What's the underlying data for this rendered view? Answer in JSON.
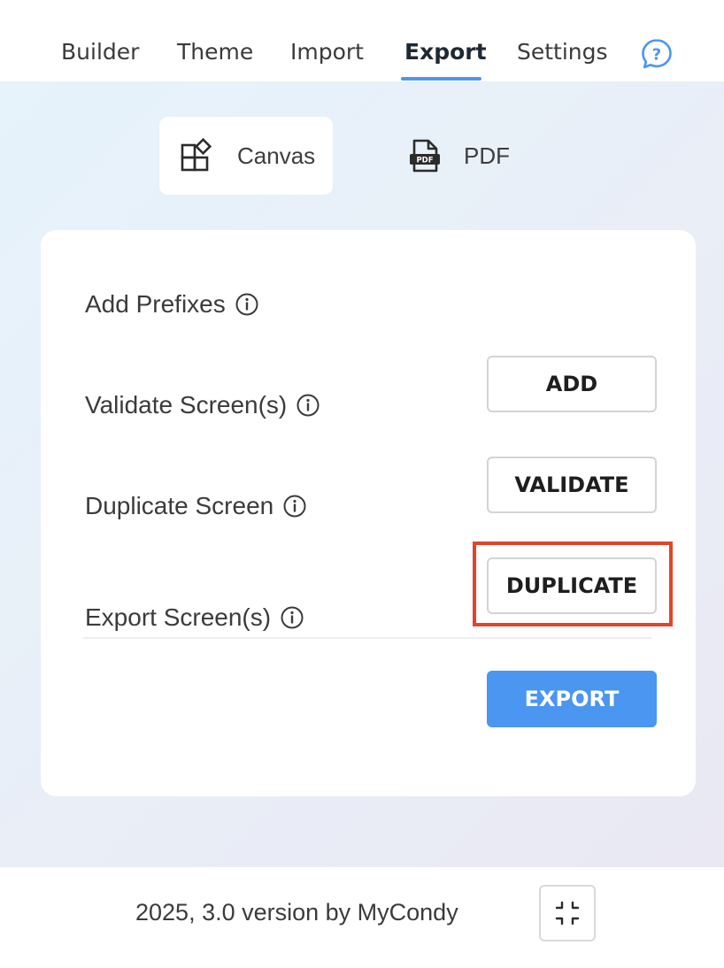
{
  "nav": {
    "tabs": [
      {
        "label": "Builder"
      },
      {
        "label": "Theme"
      },
      {
        "label": "Import"
      },
      {
        "label": "Export"
      },
      {
        "label": "Settings"
      }
    ],
    "active_tab": "Export",
    "help_icon": "question-chat-icon"
  },
  "subtabs": {
    "canvas": {
      "label": "Canvas",
      "icon": "canvas-shapes-icon",
      "selected": true
    },
    "pdf": {
      "label": "PDF",
      "icon": "pdf-file-icon",
      "selected": false
    }
  },
  "rows": {
    "prefixes": {
      "label": "Add Prefixes",
      "button": "ADD"
    },
    "validate": {
      "label": "Validate Screen(s)",
      "button": "VALIDATE"
    },
    "duplicate": {
      "label": "Duplicate Screen",
      "button": "DUPLICATE"
    },
    "export": {
      "label": "Export Screen(s)",
      "button": "EXPORT"
    }
  },
  "footer": {
    "text": "2025, 3.0 version by MyCondy",
    "collapse_icon": "collapse-arrows-icon"
  },
  "colors": {
    "accent": "#4a96f0",
    "highlight": "#e0452a"
  }
}
